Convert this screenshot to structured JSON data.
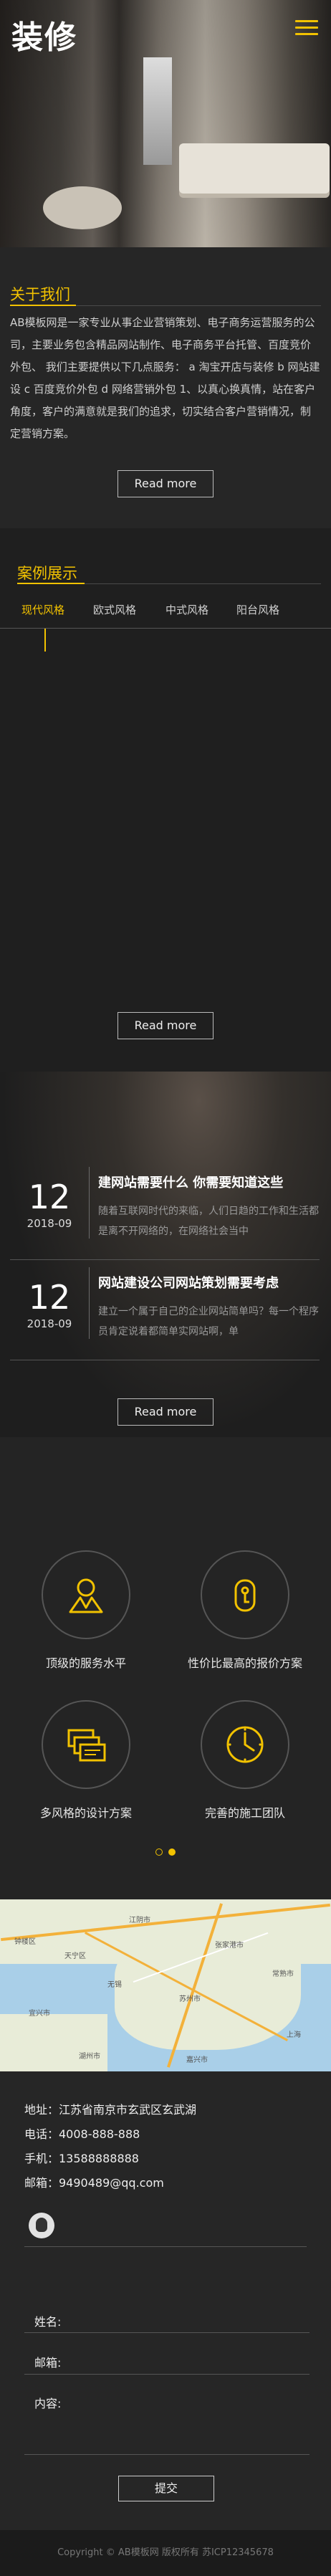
{
  "header": {
    "logo": "装修",
    "menu_icon": "hamburger-menu-icon",
    "accent": "#f2c200"
  },
  "about": {
    "title": "关于我们",
    "body": "AB模板网是一家专业从事企业营销策划、电子商务运营服务的公司，主要业务包含精品网站制作、电子商务平台托管、百度竞价外包、 我们主要提供以下几点服务： a 淘宝开店与装修 b 网站建设 c 百度竞价外包 d 网络营销外包 1、以真心换真情，站在客户角度，客户的满意就是我们的追求，切实结合客户营销情况，制定营销方案。",
    "more": "Read more"
  },
  "cases": {
    "title": "案例展示",
    "tabs": [
      "现代风格",
      "欧式风格",
      "中式风格",
      "阳台风格"
    ],
    "more": "Read more"
  },
  "news": {
    "items": [
      {
        "day": "12",
        "ym": "2018-09",
        "title": "建网站需要什么 你需要知道这些",
        "desc": "随着互联网时代的来临，人们日趋的工作和生活都是离不开网络的，在网络社会当中"
      },
      {
        "day": "12",
        "ym": "2018-09",
        "title": "网站建设公司网站策划需要考虑",
        "desc": "建立一个属于自己的企业网站简单吗？每一个程序员肯定说着都简单实网站啊，单"
      }
    ],
    "more": "Read more"
  },
  "services": {
    "items": [
      {
        "label": "顶级的服务水平",
        "icon": "person-icon"
      },
      {
        "label": "性价比最高的报价方案",
        "icon": "tag-icon"
      },
      {
        "label": "多风格的设计方案",
        "icon": "stacked-cards-icon"
      },
      {
        "label": "完善的施工团队",
        "icon": "clock-icon"
      }
    ]
  },
  "map": {
    "labels": [
      "钟楼区",
      "天宁区",
      "江阴市",
      "张家港市",
      "常熟市",
      "宜兴市",
      "苏州市",
      "上海",
      "无锡",
      "湖州市",
      "嘉兴市"
    ]
  },
  "contact": {
    "address": "地址：江苏省南京市玄武区玄武湖",
    "phone": "电话：4008-888-888",
    "mobile": "手机：13588888888",
    "email": "邮箱：9490489@qq.com",
    "qq_icon": "qq-icon",
    "form": {
      "name": "姓名:",
      "email": "邮箱:",
      "content": "内容:",
      "submit": "提交"
    }
  },
  "footer": {
    "copyright": "Copyright © AB模板网 版权所有 苏ICP12345678"
  }
}
